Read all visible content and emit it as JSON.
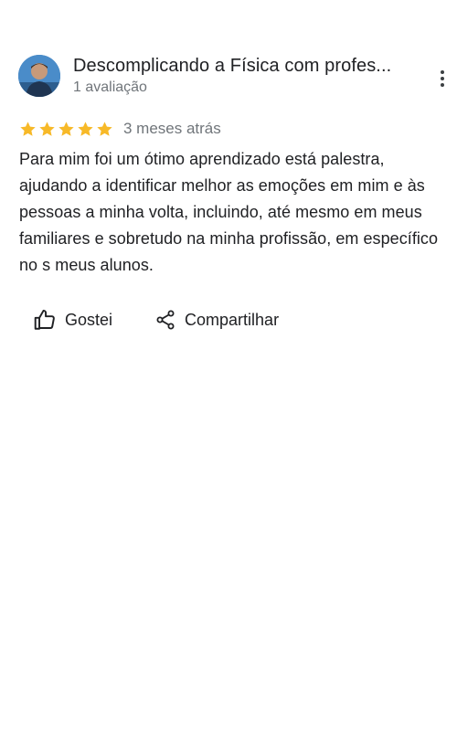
{
  "review": {
    "author_name": "Descomplicando a Física com profes...",
    "author_meta": "1 avaliação",
    "rating": 5,
    "rating_max": 5,
    "date": "3 meses atrás",
    "text": "Para mim foi um ótimo aprendizado está palestra, ajudando a identificar melhor as emoções em mim e às pessoas a minha volta, incluindo, até mesmo em meus familiares e sobretudo na minha profissão, em específico no s meus alunos."
  },
  "actions": {
    "like_label": "Gostei",
    "share_label": "Compartilhar"
  },
  "icons": {
    "more": "more-vert-icon",
    "like": "thumb-up-icon",
    "share": "share-icon",
    "star": "star-icon"
  },
  "colors": {
    "star": "#f7b928",
    "text": "#202124",
    "meta": "#70757a"
  }
}
